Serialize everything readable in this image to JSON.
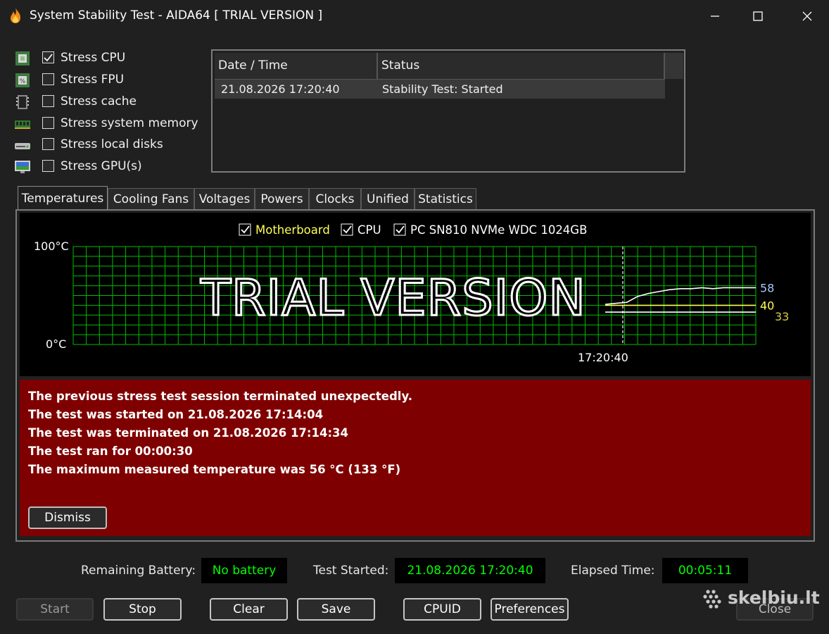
{
  "window": {
    "title": "System Stability Test - AIDA64  [ TRIAL VERSION ]",
    "controls": [
      "minimize-icon",
      "maximize-icon",
      "close-icon"
    ]
  },
  "stress_options": [
    {
      "label": "Stress CPU",
      "checked": true,
      "icon": "cpu-chip-icon"
    },
    {
      "label": "Stress FPU",
      "checked": false,
      "icon": "fpu-chip-icon"
    },
    {
      "label": "Stress cache",
      "checked": false,
      "icon": "cache-icon"
    },
    {
      "label": "Stress system memory",
      "checked": false,
      "icon": "memory-module-icon"
    },
    {
      "label": "Stress local disks",
      "checked": false,
      "icon": "disk-drive-icon"
    },
    {
      "label": "Stress GPU(s)",
      "checked": false,
      "icon": "gpu-monitor-icon"
    }
  ],
  "log": {
    "columns": [
      "Date / Time",
      "Status"
    ],
    "rows": [
      {
        "datetime": "21.08.2026 17:20:40",
        "status": "Stability Test: Started"
      }
    ]
  },
  "tabs": [
    {
      "label": "Temperatures",
      "active": true
    },
    {
      "label": "Cooling Fans",
      "active": false
    },
    {
      "label": "Voltages",
      "active": false
    },
    {
      "label": "Powers",
      "active": false
    },
    {
      "label": "Clocks",
      "active": false
    },
    {
      "label": "Unified",
      "active": false
    },
    {
      "label": "Statistics",
      "active": false
    }
  ],
  "chart_data": {
    "type": "line",
    "legend": [
      {
        "name": "Motherboard",
        "checked": true,
        "color": "#ffff55"
      },
      {
        "name": "CPU",
        "checked": true,
        "color": "#ffffff"
      },
      {
        "name": "PC SN810 NVMe WDC 1024GB",
        "checked": true,
        "color": "#ffffff"
      }
    ],
    "y_top_label": "100°C",
    "y_bottom_label": "0°C",
    "ylim": [
      0,
      100
    ],
    "x_marker_label": "17:20:40",
    "watermark": "TRIAL VERSION",
    "grid": true,
    "grid_color": "#00bb00",
    "series": [
      {
        "name": "CPU",
        "color": "#ffffff",
        "values": [
          41,
          42,
          43,
          49,
          52,
          54,
          56,
          57,
          57,
          58,
          57,
          58,
          58,
          58,
          58
        ],
        "end_label": "58",
        "label_color": "#a9c8ff"
      },
      {
        "name": "Motherboard",
        "color": "#ffff55",
        "values": [
          40,
          40,
          40,
          40,
          40,
          40,
          40,
          40,
          40,
          40,
          40,
          40,
          40,
          40,
          40
        ],
        "end_label": "40",
        "label_color": "#ffff55"
      },
      {
        "name": "PC SN810 NVMe WDC 1024GB",
        "color": "#ffffff",
        "values": [
          33,
          33,
          33,
          33,
          33,
          33,
          33,
          33,
          33,
          33,
          33,
          33,
          33,
          33,
          33
        ],
        "end_label": "33",
        "label_color": "#d8c840"
      }
    ]
  },
  "alert": {
    "lines": [
      "The previous stress test session terminated unexpectedly.",
      "The test was started on 21.08.2026 17:14:04",
      "The test was terminated on 21.08.2026 17:14:34",
      "The test ran for 00:00:30",
      "The maximum measured temperature was 56 °C  (133 °F)"
    ],
    "dismiss_label": "Dismiss",
    "background": "#7f0000"
  },
  "status": {
    "battery_label": "Remaining Battery:",
    "battery_value": "No battery",
    "started_label": "Test Started:",
    "started_value": "21.08.2026 17:20:40",
    "elapsed_label": "Elapsed Time:",
    "elapsed_value": "00:05:11"
  },
  "buttons": {
    "start": "Start",
    "stop": "Stop",
    "clear": "Clear",
    "save": "Save",
    "cpuid": "CPUID",
    "preferences": "Preferences",
    "close": "Close"
  },
  "watermark": {
    "text": "skelbiu.lt"
  }
}
